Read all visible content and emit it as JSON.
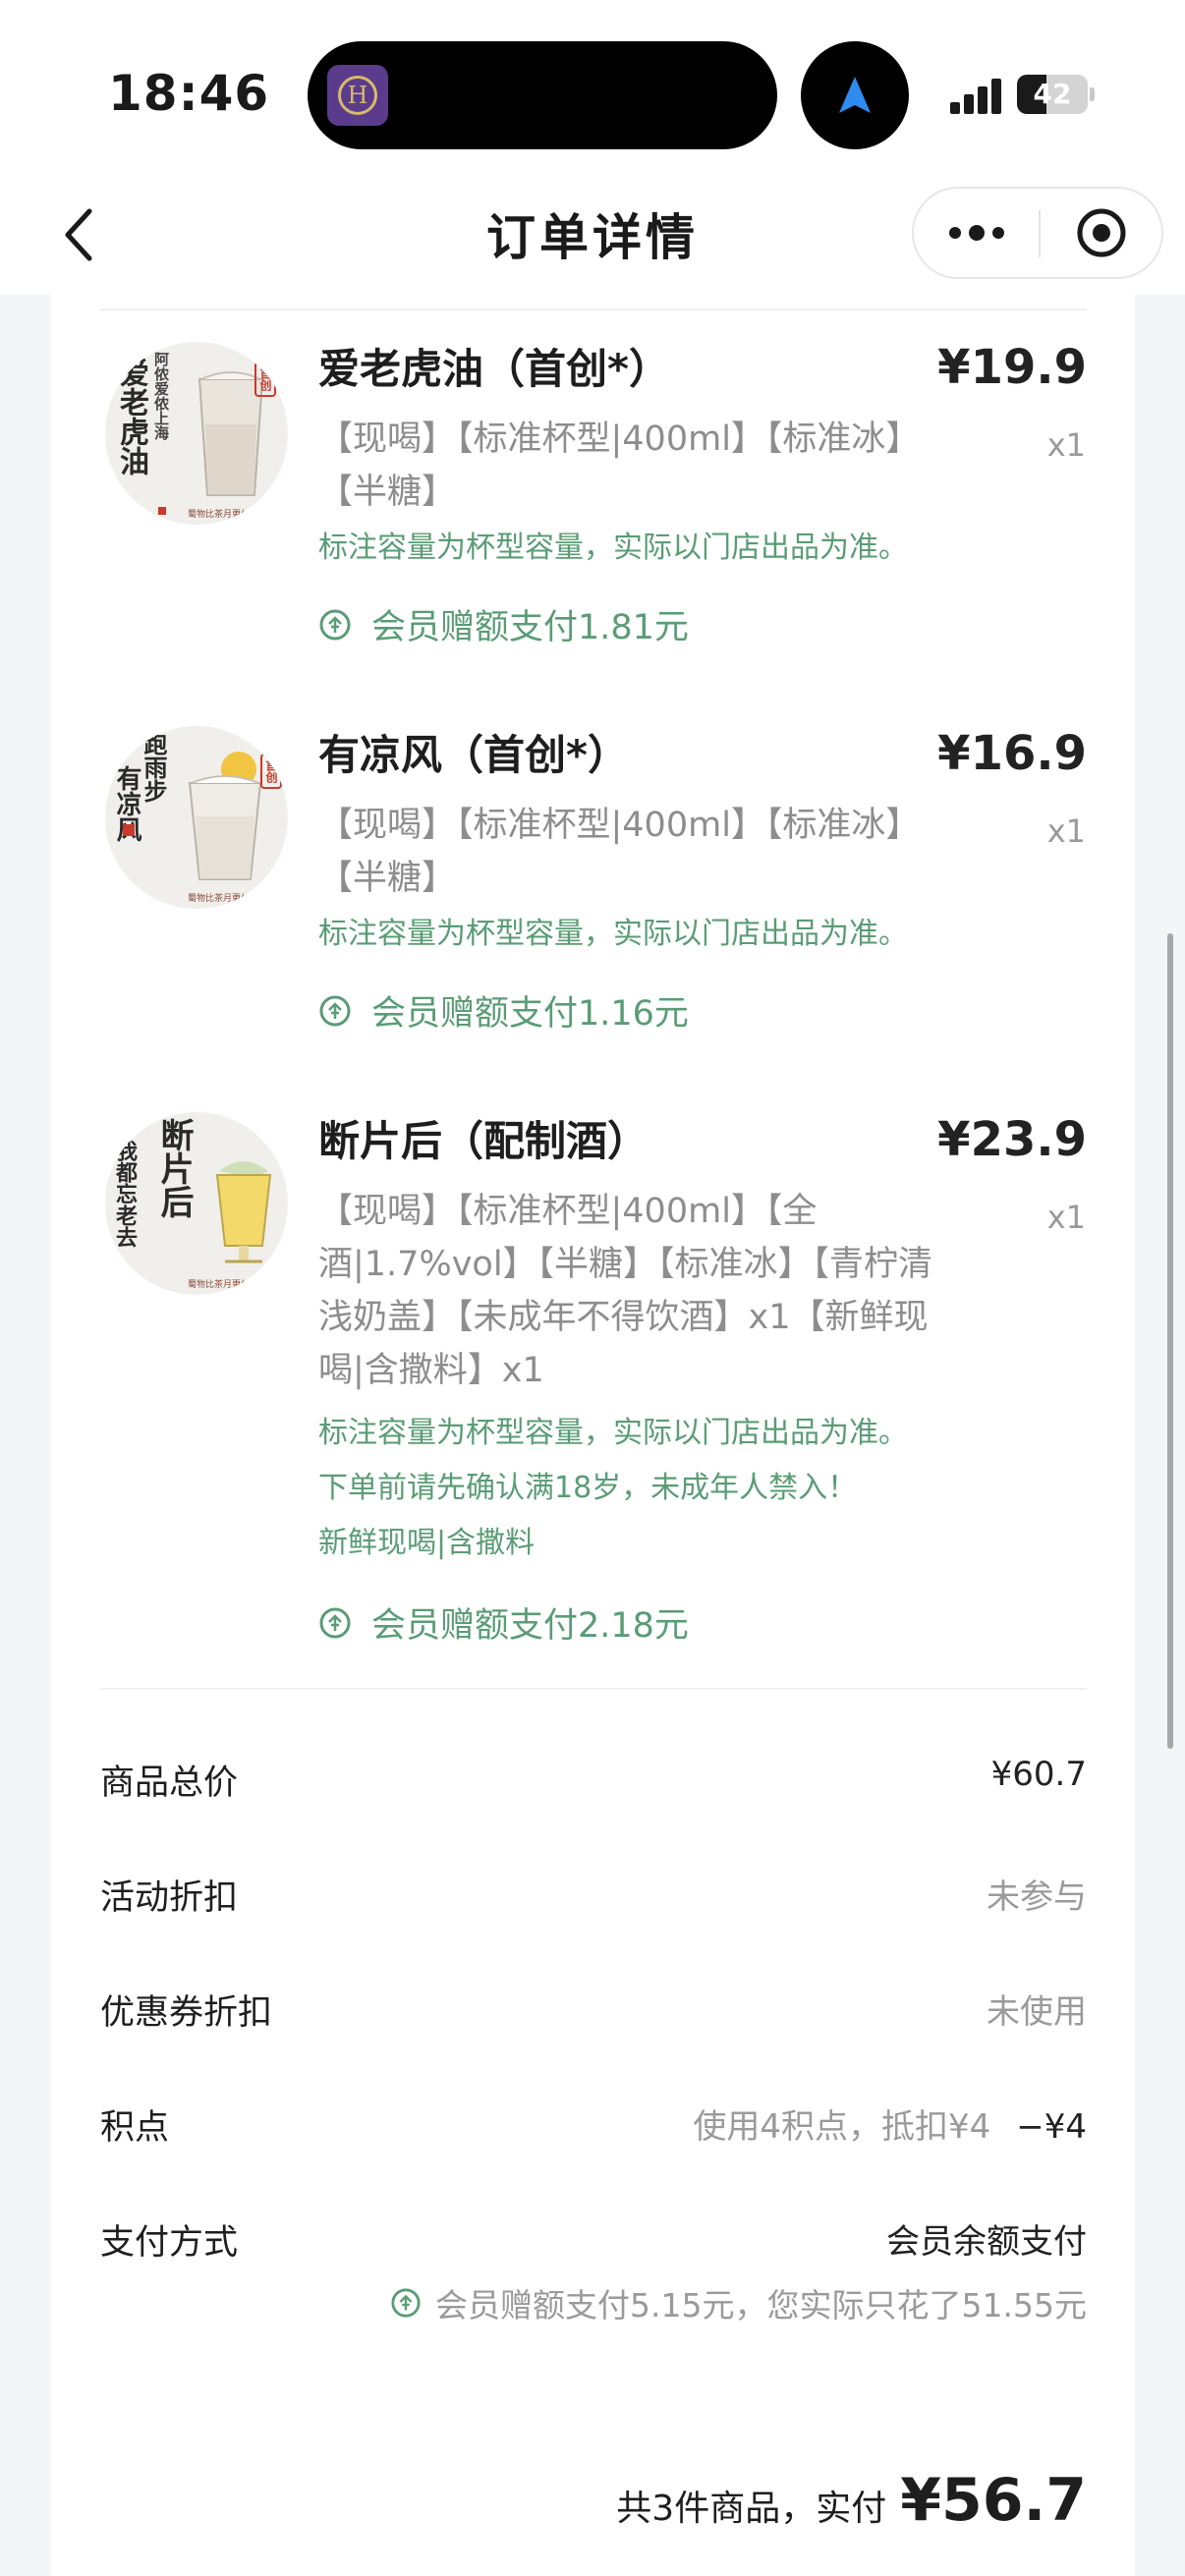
{
  "status_bar": {
    "time": "18:46",
    "battery": "42",
    "battery_level": 0.42
  },
  "header": {
    "title": "订单详情"
  },
  "items": [
    {
      "name": "爱老虎油（首创*）",
      "price": "¥19.9",
      "qty": "x1",
      "spec": "【现喝】【标准杯型|400ml】【标准冰】【半糖】",
      "notes": [
        "标注容量为杯型容量，实际以门店出品为准。"
      ],
      "member_pay": "会员赠额支付1.81元",
      "thumb": {
        "calligraphy": "爱老虎油",
        "calligraphy_small": "阿侬爱侬上海",
        "badge": "首创",
        "caption": "蜀物比茶月更付茶"
      }
    },
    {
      "name": "有凉风（首创*）",
      "price": "¥16.9",
      "qty": "x1",
      "spec": "【现喝】【标准杯型|400ml】【标准冰】【半糖】",
      "notes": [
        "标注容量为杯型容量，实际以门店出品为准。"
      ],
      "member_pay": "会员赠额支付1.16元",
      "thumb": {
        "calligraphy": "有凉风",
        "calligraphy_small": "跑雨步",
        "badge": "首创",
        "caption": "蜀物比茶月更付茶"
      }
    },
    {
      "name": "断片后（配制酒）",
      "price": "¥23.9",
      "qty": "x1",
      "spec": "【现喝】【标准杯型|400ml】【全酒|1.7%vol】【半糖】【标准冰】【青柠清浅奶盖】【未成年不得饮酒】x1【新鲜现喝|含撒料】x1",
      "notes": [
        "标注容量为杯型容量，实际以门店出品为准。",
        "下单前请先确认满18岁，未成年人禁入！",
        "新鲜现喝|含撒料"
      ],
      "member_pay": "会员赠额支付2.18元",
      "thumb": {
        "calligraphy": "断片后",
        "calligraphy_small": "我都忘老去",
        "caption": "蜀物比茶月更付茶"
      }
    }
  ],
  "summary": {
    "goods_total_label": "商品总价",
    "goods_total_value": "¥60.7",
    "activity_label": "活动折扣",
    "activity_value": "未参与",
    "coupon_label": "优惠券折扣",
    "coupon_value": "未使用",
    "points_label": "积点",
    "points_detail": "使用4积点，抵扣¥4",
    "points_value": "−¥4",
    "payment_label": "支付方式",
    "payment_value": "会员余额支付",
    "payment_note": "会员赠额支付5.15元，您实际只花了51.55元"
  },
  "total": {
    "label": "共3件商品，实付",
    "amount": "¥56.7"
  },
  "colors": {
    "accent_green": "#5a9c76",
    "muted_text": "#9a9a9a",
    "background": "#f4f5f6",
    "card": "#ffffff"
  },
  "icons": [
    "chevron-left-icon",
    "more-dots-icon",
    "close-circle-icon",
    "location-arrow-icon",
    "cellular-signal-icon",
    "member-pay-icon"
  ]
}
